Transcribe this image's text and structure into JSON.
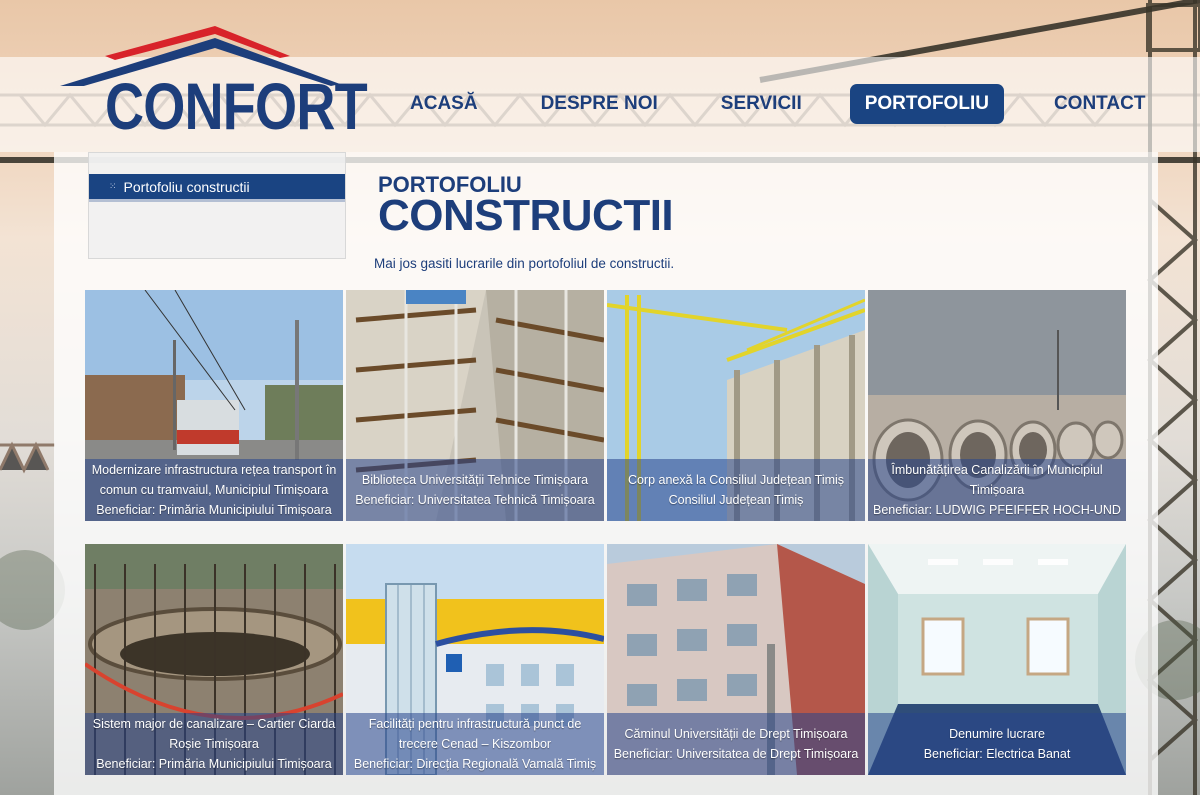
{
  "brand": {
    "logo_text": "CONFORT"
  },
  "nav": [
    {
      "label": "ACASĂ",
      "active": false
    },
    {
      "label": "DESPRE NOI",
      "active": false
    },
    {
      "label": "SERVICII",
      "active": false
    },
    {
      "label": "PORTOFOLIU",
      "active": true
    },
    {
      "label": "CONTACT",
      "active": false
    }
  ],
  "sidebar": {
    "items": [
      {
        "label": "Portofoliu constructii"
      }
    ]
  },
  "page": {
    "kicker": "PORTOFOLIU",
    "title": "CONSTRUCTII",
    "intro": "Mai jos gasiti lucrarile din portofoliul de constructii."
  },
  "projects": [
    {
      "line1": "Modernizare infrastructura rețea transport în",
      "line2": "comun cu tramvaiul, Municipiul Timișoara",
      "line3": "Beneficiar: Primăria Municipiului Timișoara",
      "icon": "tram-photo"
    },
    {
      "line1": "Biblioteca Universității Tehnice Timișoara",
      "line2": "Beneficiar: Universitatea Tehnică Timișoara",
      "line3": "",
      "icon": "scaffolding-photo"
    },
    {
      "line1": "Corp anexă la Consiliul Județean Timiș",
      "line2": "Consiliul Județean Timiș",
      "line3": "",
      "icon": "crane-photo"
    },
    {
      "line1": "Îmbunătățirea Canalizării în Municipiul",
      "line2": "Timișoara",
      "line3": "Beneficiar: LUDWIG PFEIFFER HOCH-UND",
      "icon": "pipes-photo"
    },
    {
      "line1": "Sistem major de canalizare – Cartier Ciarda",
      "line2": "Roșie Timișoara",
      "line3": "Beneficiar: Primăria Municipiului Timișoara",
      "icon": "rebar-photo"
    },
    {
      "line1": "Facilități pentru infrastructură punct de",
      "line2": "trecere Cenad – Kiszombor",
      "line3": "Beneficiar: Direcția Regională Vamală Timiș",
      "icon": "yellow-building-photo"
    },
    {
      "line1": "Căminul Universității de Drept Timișoara",
      "line2": "Beneficiar: Universitatea de Drept Timișoara",
      "line3": "",
      "icon": "dormitory-photo"
    },
    {
      "line1": "Denumire lucrare",
      "line2": "Beneficiar: Electrica Banat",
      "line3": "",
      "icon": "office-interior-photo"
    }
  ],
  "colors": {
    "brand_blue": "#1d3e7b",
    "active_nav": "#1a4482",
    "roof_red": "#d8232a"
  }
}
